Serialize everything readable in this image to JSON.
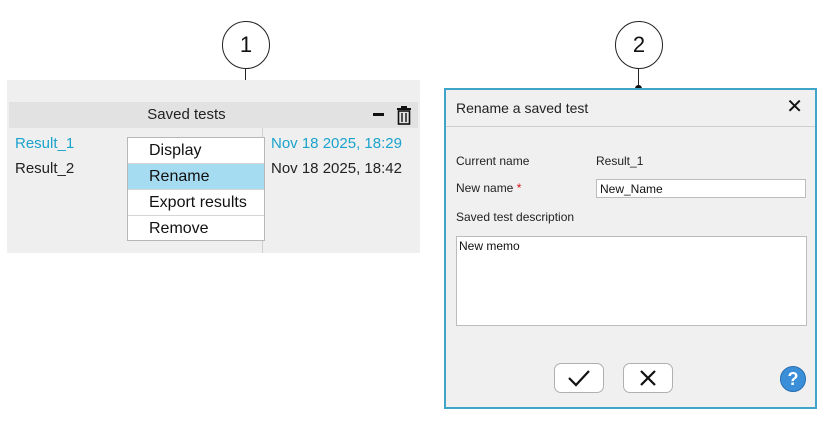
{
  "callouts": {
    "one": "1",
    "two": "2"
  },
  "saved_tests": {
    "title": "Saved tests",
    "rows": [
      {
        "name": "Result_1",
        "date": "Nov 18 2025, 18:29",
        "highlighted": true
      },
      {
        "name": "Result_2",
        "date": "Nov 18 2025, 18:42",
        "highlighted": false
      }
    ],
    "highlight_color": "#1aa3cc"
  },
  "context_menu": {
    "items": [
      {
        "label": "Display"
      },
      {
        "label": "Rename",
        "selected": true
      },
      {
        "label": "Export results"
      },
      {
        "label": "Remove"
      }
    ],
    "selected_color": "#a6dcf1"
  },
  "dialog": {
    "title": "Rename a saved test",
    "current_name_label": "Current name",
    "current_name_value": "Result_1",
    "new_name_label": "New name",
    "required_mark": "*",
    "new_name_value": "New_Name",
    "description_label": "Saved test description",
    "description_value": "New memo",
    "border_color": "#3ea5c8",
    "help_color": "#3a8fd8"
  }
}
